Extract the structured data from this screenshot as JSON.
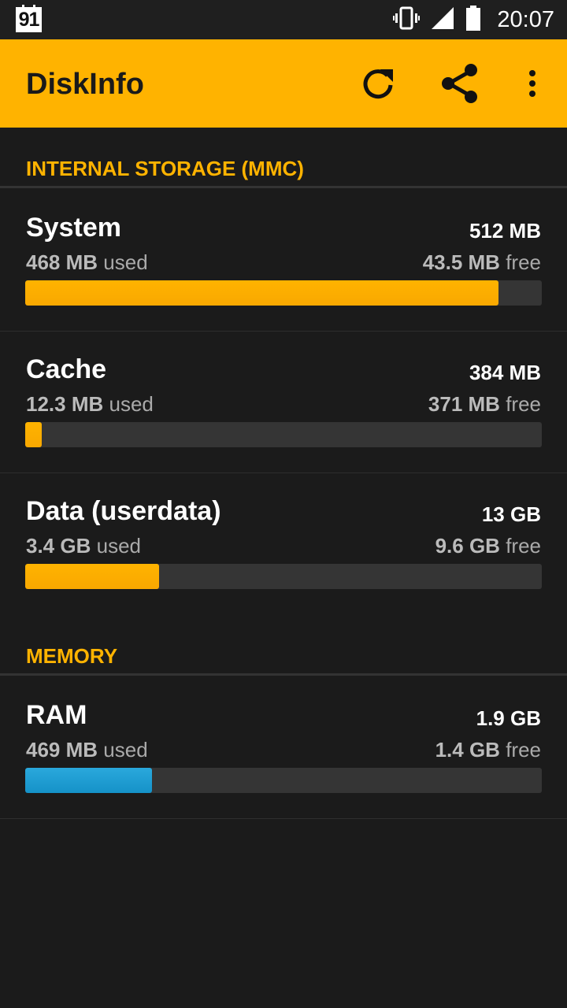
{
  "status_bar": {
    "notification_text": "91",
    "time": "20:07",
    "icons": [
      "vibrate-icon",
      "signal-icon",
      "battery-icon"
    ]
  },
  "app_bar": {
    "title": "DiskInfo",
    "icons": [
      "refresh-icon",
      "share-icon",
      "overflow-menu-icon"
    ],
    "accent_color": "#ffb300"
  },
  "sections": {
    "internal": {
      "title": "INTERNAL STORAGE (MMC)",
      "items": [
        {
          "name": "System",
          "total": "512 MB",
          "used_value": "468 MB",
          "used_suffix": "used",
          "free_value": "43.5 MB",
          "free_suffix": "free",
          "usage_fraction": 0.916,
          "color": "#ffb300"
        },
        {
          "name": "Cache",
          "total": "384 MB",
          "used_value": "12.3 MB",
          "used_suffix": "used",
          "free_value": "371 MB",
          "free_suffix": "free",
          "usage_fraction": 0.032,
          "color": "#ffb300"
        },
        {
          "name": "Data (userdata)",
          "total": "13 GB",
          "used_value": "3.4 GB",
          "used_suffix": "used",
          "free_value": "9.6 GB",
          "free_suffix": "free",
          "usage_fraction": 0.259,
          "color": "#ffb300"
        }
      ]
    },
    "memory": {
      "title": "MEMORY",
      "items": [
        {
          "name": "RAM",
          "total": "1.9 GB",
          "used_value": "469 MB",
          "used_suffix": "used",
          "free_value": "1.4 GB",
          "free_suffix": "free",
          "usage_fraction": 0.245,
          "color": "#1fa0d6"
        }
      ]
    }
  }
}
